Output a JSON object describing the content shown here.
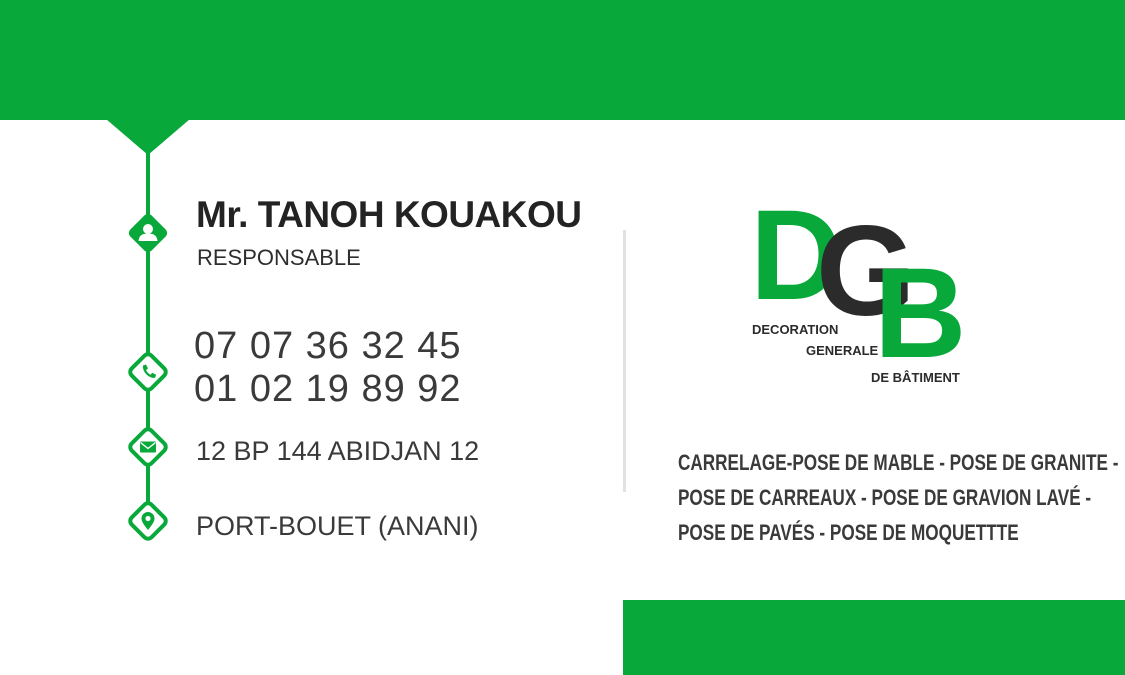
{
  "person": {
    "name": "Mr. TANOH KOUAKOU",
    "role": "RESPONSABLE"
  },
  "contacts": {
    "phone_1": "07 07 36 32 45",
    "phone_2": "01 02 19 89 92",
    "postal_address": "12 BP 144 ABIDJAN 12",
    "location": "PORT-BOUET (ANANI)"
  },
  "icons": {
    "person": "user-icon",
    "phone": "phone-icon",
    "mail": "mail-icon",
    "location": "location-pin-icon"
  },
  "logo": {
    "letter_1": "D",
    "letter_2": "G",
    "letter_3": "B",
    "line_1": "DECORATION",
    "line_2": "GENERALE",
    "line_3": "DE BÂTIMENT"
  },
  "services": [
    "CARRELAGE-POSE DE MABLE - POSE DE GRANITE -",
    "POSE DE CARREAUX - POSE DE GRAVION LAVÉ -",
    "POSE DE PAVÉS - POSE DE MOQUETTTE"
  ],
  "colors": {
    "brand_green": "#08a93a",
    "text_dark": "#232323",
    "logo_dark": "#2b2b2b"
  }
}
